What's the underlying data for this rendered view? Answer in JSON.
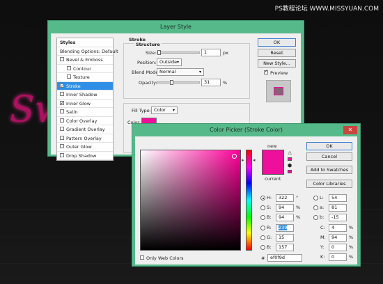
{
  "watermark": "PS教程论坛 WWW.MISSYUAN.COM",
  "background": {
    "text": "Sweet"
  },
  "layer_style": {
    "title": "Layer Style",
    "close_glyph": "✕",
    "styles_header": "Styles",
    "blending_options": "Blending Options: Default",
    "items": [
      {
        "label": "Bevel & Emboss",
        "checked": false,
        "selected": false
      },
      {
        "label": "Contour",
        "checked": false,
        "selected": false,
        "indent": true
      },
      {
        "label": "Texture",
        "checked": false,
        "selected": false,
        "indent": true
      },
      {
        "label": "Stroke",
        "checked": true,
        "selected": true
      },
      {
        "label": "Inner Shadow",
        "checked": false,
        "selected": false
      },
      {
        "label": "Inner Glow",
        "checked": true,
        "selected": false
      },
      {
        "label": "Satin",
        "checked": false,
        "selected": false
      },
      {
        "label": "Color Overlay",
        "checked": false,
        "selected": false
      },
      {
        "label": "Gradient Overlay",
        "checked": false,
        "selected": false
      },
      {
        "label": "Pattern Overlay",
        "checked": false,
        "selected": false
      },
      {
        "label": "Outer Glow",
        "checked": false,
        "selected": false
      },
      {
        "label": "Drop Shadow",
        "checked": false,
        "selected": false
      }
    ],
    "stroke": {
      "section_title": "Stroke",
      "structure_title": "Structure",
      "size_label": "Size:",
      "size_value": "1",
      "size_unit": "px",
      "position_label": "Position:",
      "position_value": "Outside",
      "blend_label": "Blend Mode:",
      "blend_value": "Normal",
      "opacity_label": "Opacity:",
      "opacity_value": "31",
      "opacity_unit": "%",
      "opacity_level": 0.31,
      "fill_type_label": "Fill Type:",
      "fill_type_value": "Color",
      "color_label": "Color:"
    },
    "buttons": {
      "ok": "OK",
      "reset": "Reset",
      "new_style": "New Style...",
      "preview": "Preview"
    },
    "preview_checked": true
  },
  "color_picker": {
    "title": "Color Picker (Stroke Color)",
    "close_glyph": "✕",
    "new_label": "new",
    "current_label": "current",
    "buttons": {
      "ok": "OK",
      "cancel": "Cancel",
      "add_swatches": "Add to Swatches",
      "color_libraries": "Color Libraries"
    },
    "only_web_colors": "Only Web Colors",
    "hsb": [
      {
        "label": "H:",
        "value": "322",
        "unit": "°",
        "selected": true
      },
      {
        "label": "S:",
        "value": "94",
        "unit": "%",
        "selected": false
      },
      {
        "label": "B:",
        "value": "94",
        "unit": "%",
        "selected": false
      }
    ],
    "rgb": [
      {
        "label": "R:",
        "value": "239"
      },
      {
        "label": "G:",
        "value": "15"
      },
      {
        "label": "B:",
        "value": "157"
      }
    ],
    "lab": [
      {
        "label": "L:",
        "value": "54"
      },
      {
        "label": "a:",
        "value": "81"
      },
      {
        "label": "b:",
        "value": "-15"
      }
    ],
    "cmyk": [
      {
        "label": "C:",
        "value": "4",
        "unit": "%"
      },
      {
        "label": "M:",
        "value": "94",
        "unit": "%"
      },
      {
        "label": "Y:",
        "value": "0",
        "unit": "%"
      },
      {
        "label": "K:",
        "value": "0",
        "unit": "%"
      }
    ],
    "hex_label": "#",
    "hex_value": "ef0f9d"
  },
  "colors": {
    "accent": "#ef0f9d",
    "window": "#56b98a",
    "selection": "#2f8fe6"
  }
}
